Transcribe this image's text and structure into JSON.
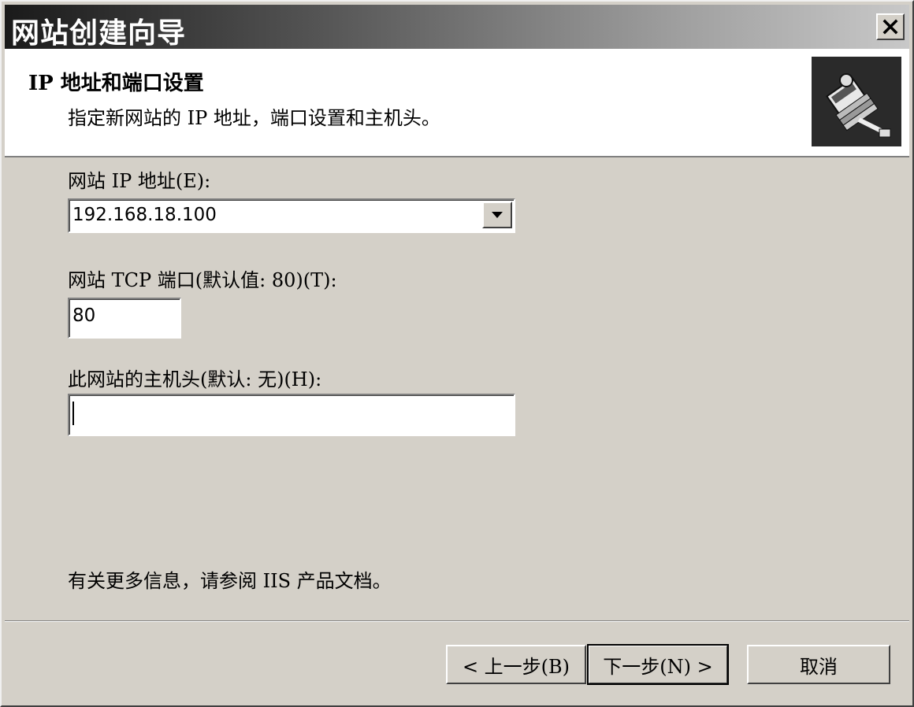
{
  "window": {
    "title": "网站创建向导"
  },
  "header": {
    "title": "IP 地址和端口设置",
    "subtitle": "指定新网站的 IP 地址，端口设置和主机头。"
  },
  "ip": {
    "label": "网站 IP 地址(E):",
    "value": "192.168.18.100"
  },
  "port": {
    "label": "网站 TCP 端口(默认值: 80)(T):",
    "value": "80"
  },
  "host": {
    "label": "此网站的主机头(默认: 无)(H):",
    "value": ""
  },
  "info": "有关更多信息，请参阅 IIS 产品文档。",
  "buttons": {
    "back": "< 上一步(B)",
    "next": "下一步(N) >",
    "cancel": "取消"
  }
}
